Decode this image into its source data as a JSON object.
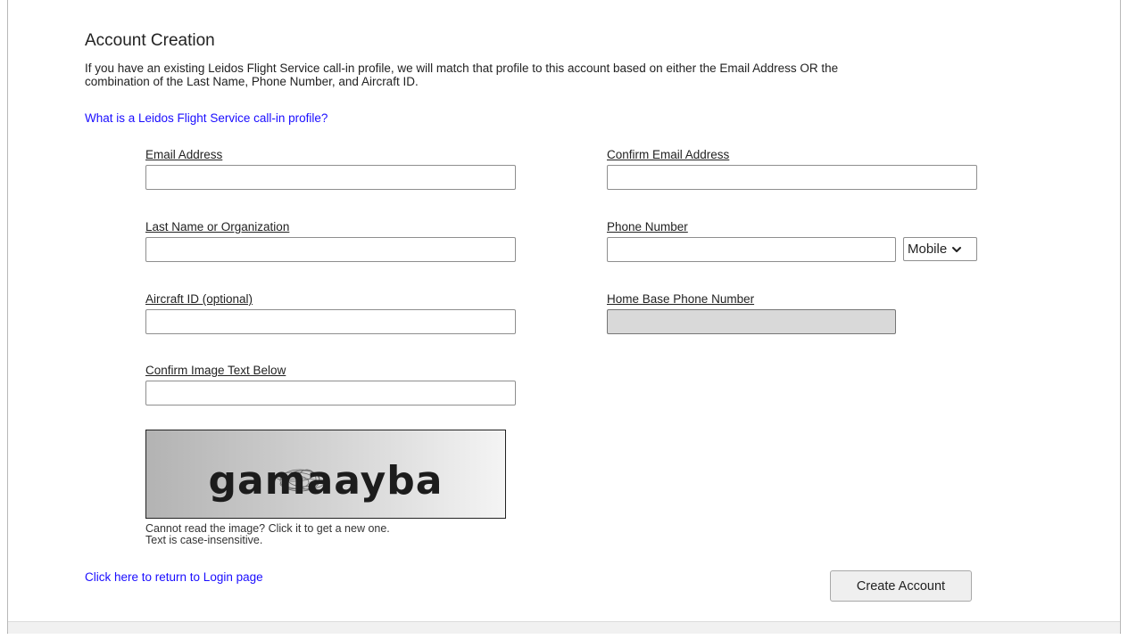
{
  "page": {
    "title": "Account Creation",
    "intro_line1": "If you have an existing Leidos Flight Service call-in profile, we will match that profile to this account based on either the Email Address OR the",
    "intro_line2": "combination of the Last Name, Phone Number, and Aircraft ID.",
    "profile_help_link": "What is a Leidos Flight Service call-in profile?"
  },
  "form": {
    "email_label": "Email Address",
    "email_value": "",
    "confirm_email_label": "Confirm Email Address",
    "confirm_email_value": "",
    "last_name_label": "Last Name or Organization",
    "last_name_value": "",
    "phone_label": "Phone Number",
    "phone_value": "",
    "phone_type_selected": "Mobile",
    "aircraft_label": "Aircraft ID (optional)",
    "aircraft_value": "",
    "home_phone_label": "Home Base Phone Number",
    "home_phone_value": "",
    "captcha_label": "Confirm Image Text Below",
    "captcha_value": ""
  },
  "captcha": {
    "image_text": "gamaayba",
    "help_line1": "Cannot read the image? Click it to get a new one.",
    "help_line2": "Text is case-insensitive."
  },
  "footer": {
    "login_link": "Click here to return to Login page",
    "create_button": "Create Account"
  },
  "colors": {
    "link": "#1a0dff",
    "disabled_field": "#d9d9d9"
  },
  "icons": {
    "select_arrow": "chevron-down-icon"
  }
}
